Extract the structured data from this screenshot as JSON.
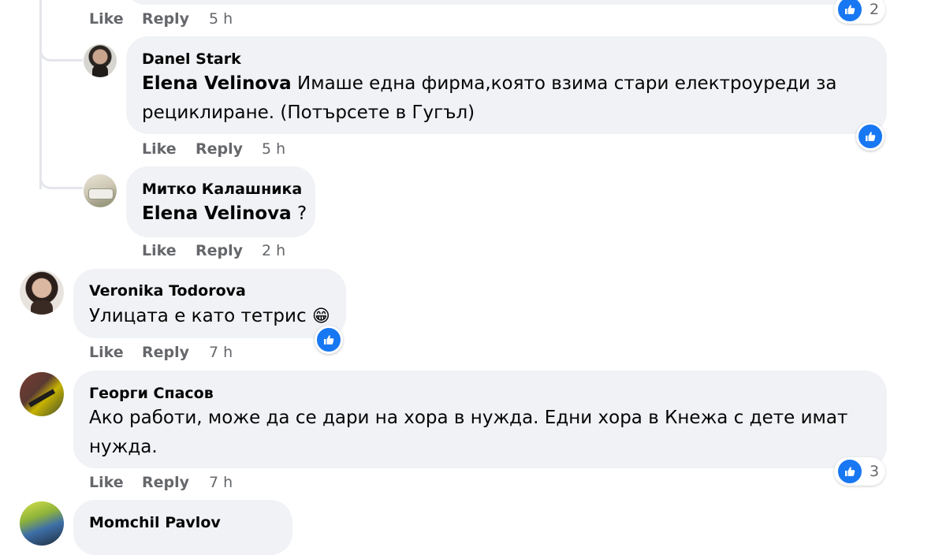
{
  "comments": [
    {
      "actions": {
        "like": "Like",
        "reply": "Reply",
        "time": "5 h"
      },
      "reactions": {
        "count": "2"
      }
    },
    {
      "author": "Danel Stark",
      "mention": "Elena Velinova",
      "text_line1": " Имаше една фирма,която взима стари електроуреди за",
      "text_line2": "рециклиране. (Потърсете в Гугъл)",
      "actions": {
        "like": "Like",
        "reply": "Reply",
        "time": "5 h"
      }
    },
    {
      "author": "Митко Калашника",
      "mention": "Elena Velinova",
      "text": " ?",
      "actions": {
        "like": "Like",
        "reply": "Reply",
        "time": "2 h"
      }
    },
    {
      "author": "Veronika Todorova",
      "text": "Улицата е като тетрис",
      "emoji": "😁",
      "actions": {
        "like": "Like",
        "reply": "Reply",
        "time": "7 h"
      }
    },
    {
      "author": "Георги Спасов",
      "text_line1": "Ако работи, може да се дари на хора в нужда. Едни хора в Кнежа с дете имат",
      "text_line2": "нужда.",
      "actions": {
        "like": "Like",
        "reply": "Reply",
        "time": "7 h"
      },
      "reactions": {
        "count": "3"
      }
    },
    {
      "author": "Momchil Pavlov"
    }
  ],
  "colors": {
    "bubble": "#f0f2f5",
    "meta_text": "#65676b",
    "like_blue": "#1877f2",
    "thread_line": "#e4e6eb"
  },
  "icons": [
    "like-icon",
    "avatar"
  ]
}
